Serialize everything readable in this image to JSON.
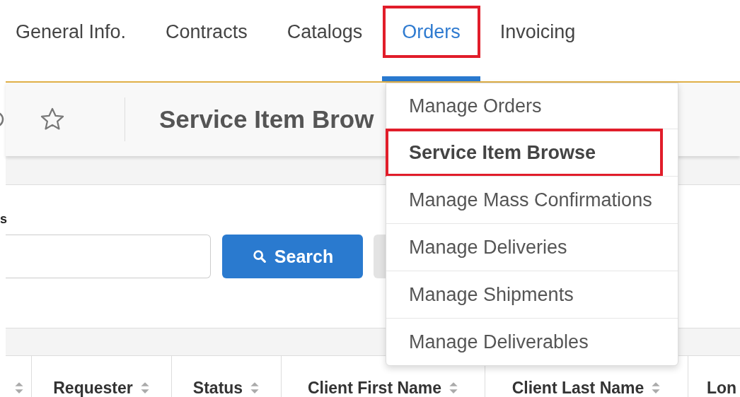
{
  "tabs": [
    {
      "label": "General Info.",
      "selected": false,
      "highlighted": false
    },
    {
      "label": "Contracts",
      "selected": false,
      "highlighted": false
    },
    {
      "label": "Catalogs",
      "selected": false,
      "highlighted": false
    },
    {
      "label": "Orders",
      "selected": true,
      "highlighted": true
    },
    {
      "label": "Invoicing",
      "selected": false,
      "highlighted": false
    }
  ],
  "header": {
    "title": "Service Item Brow",
    "starred": false
  },
  "filter": {
    "label": "s",
    "search_button": "Search"
  },
  "menu": {
    "items": [
      {
        "label": "Manage Orders",
        "selected": false,
        "highlighted": false
      },
      {
        "label": "Service Item Browse",
        "selected": true,
        "highlighted": true
      },
      {
        "label": "Manage Mass Confirmations",
        "selected": false,
        "highlighted": false
      },
      {
        "label": "Manage Deliveries",
        "selected": false,
        "highlighted": false
      },
      {
        "label": "Manage Shipments",
        "selected": false,
        "highlighted": false
      },
      {
        "label": "Manage Deliverables",
        "selected": false,
        "highlighted": false
      }
    ]
  },
  "table": {
    "columns": [
      {
        "sortable": true
      },
      {
        "label": "Requester",
        "sortable": true
      },
      {
        "label": "Status",
        "sortable": true
      },
      {
        "label": "Client First Name",
        "sortable": true
      },
      {
        "label": "Client Last Name",
        "sortable": true
      },
      {
        "label": "Lon"
      }
    ]
  }
}
